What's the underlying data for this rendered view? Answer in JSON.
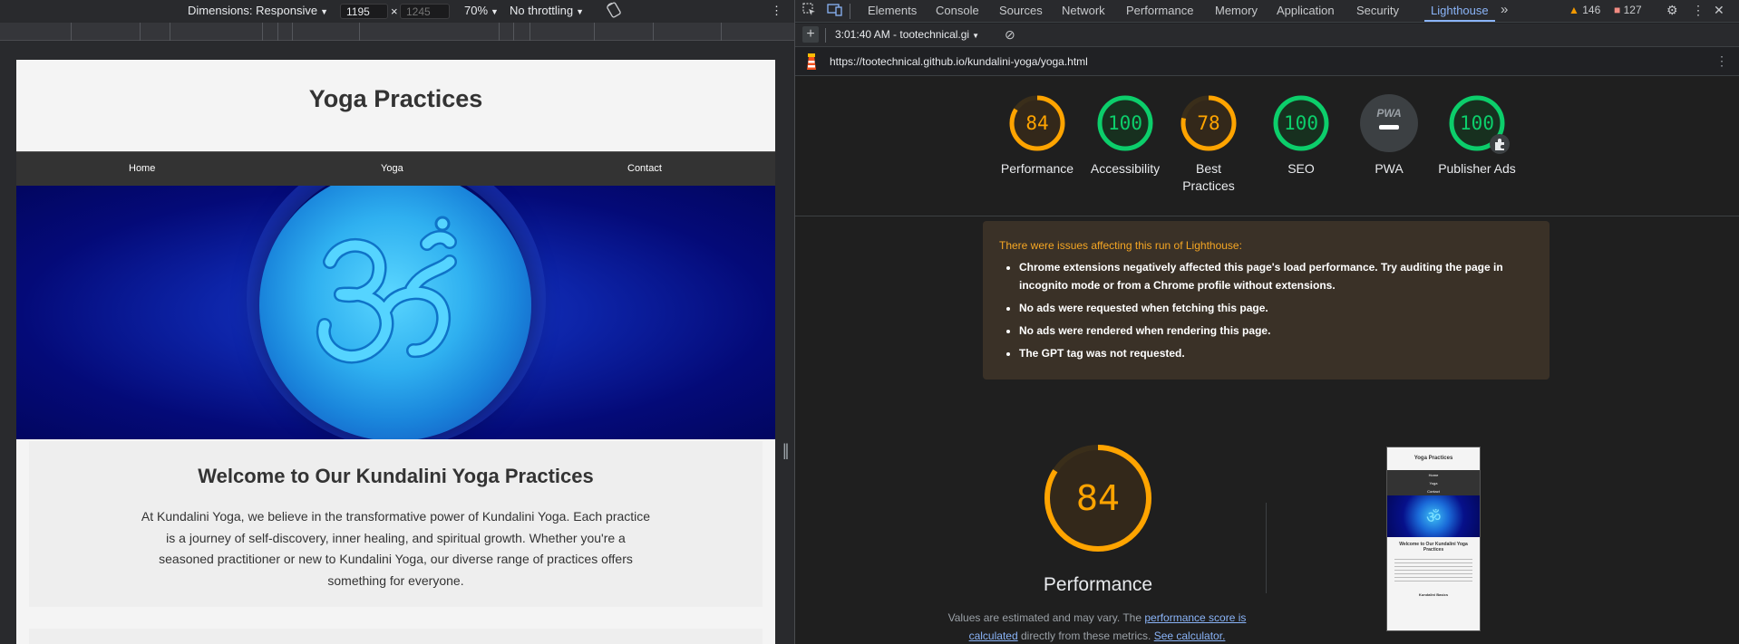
{
  "device_toolbar": {
    "dimensions_label": "Dimensions: Responsive",
    "width_value": "1195",
    "height_placeholder": "1245",
    "times": "×",
    "zoom": "70%",
    "throttling": "No throttling",
    "more": "⋮"
  },
  "site": {
    "title": "Yoga Practices",
    "nav": [
      "Home",
      "Yoga",
      "Contact"
    ],
    "welcome_title": "Welcome to Our Kundalini Yoga Practices",
    "welcome_text": "At Kundalini Yoga, we believe in the transformative power of Kundalini Yoga. Each practice is a journey of self-discovery, inner healing, and spiritual growth. Whether you're a seasoned practitioner or new to Kundalini Yoga, our diverse range of practices offers something for everyone."
  },
  "devtools": {
    "tabs": [
      "Elements",
      "Console",
      "Sources",
      "Network",
      "Performance",
      "Memory",
      "Application",
      "Security",
      "Lighthouse"
    ],
    "active_tab": "Lighthouse",
    "warnings_count": "146",
    "errors_count": "127",
    "run_label": "3:01:40 AM - tootechnical.gi",
    "url": "https://tootechnical.github.io/kundalini-yoga/yoga.html"
  },
  "lighthouse": {
    "scores": [
      {
        "label": "Performance",
        "value": "84",
        "fraction": 0.84,
        "status": "average"
      },
      {
        "label": "Accessibility",
        "value": "100",
        "fraction": 1.0,
        "status": "pass"
      },
      {
        "label": "Best Practices",
        "value": "78",
        "fraction": 0.78,
        "status": "average"
      },
      {
        "label": "SEO",
        "value": "100",
        "fraction": 1.0,
        "status": "pass"
      },
      {
        "label": "PWA",
        "value": "PWA",
        "fraction": 0,
        "status": "na"
      },
      {
        "label": "Publisher Ads",
        "value": "100",
        "fraction": 1.0,
        "status": "pass"
      }
    ],
    "warnings_title": "There were issues affecting this run of Lighthouse:",
    "warnings": [
      "Chrome extensions negatively affected this page's load performance. Try auditing the page in incognito mode or from a Chrome profile without extensions.",
      "No ads were requested when fetching this page.",
      "No ads were rendered when rendering this page.",
      "The GPT tag was not requested."
    ],
    "main_score": "84",
    "main_label": "Performance",
    "disclaimer_prefix": "Values are estimated and may vary. The ",
    "disclaimer_link1": "performance score is calculated",
    "disclaimer_mid": " directly from these metrics. ",
    "disclaimer_link2": "See calculator.",
    "thumbnail": {
      "title": "Yoga Practices",
      "nav": [
        "Home",
        "Yoga",
        "Contact"
      ],
      "welcome": "Welcome to Our Kundalini Yoga Practices",
      "section": "Kundalini Basics"
    }
  },
  "colors": {
    "pass": "#0cce6b",
    "average": "#ffa400",
    "na": "#9aa0a6",
    "accent": "#8ab4f8"
  }
}
